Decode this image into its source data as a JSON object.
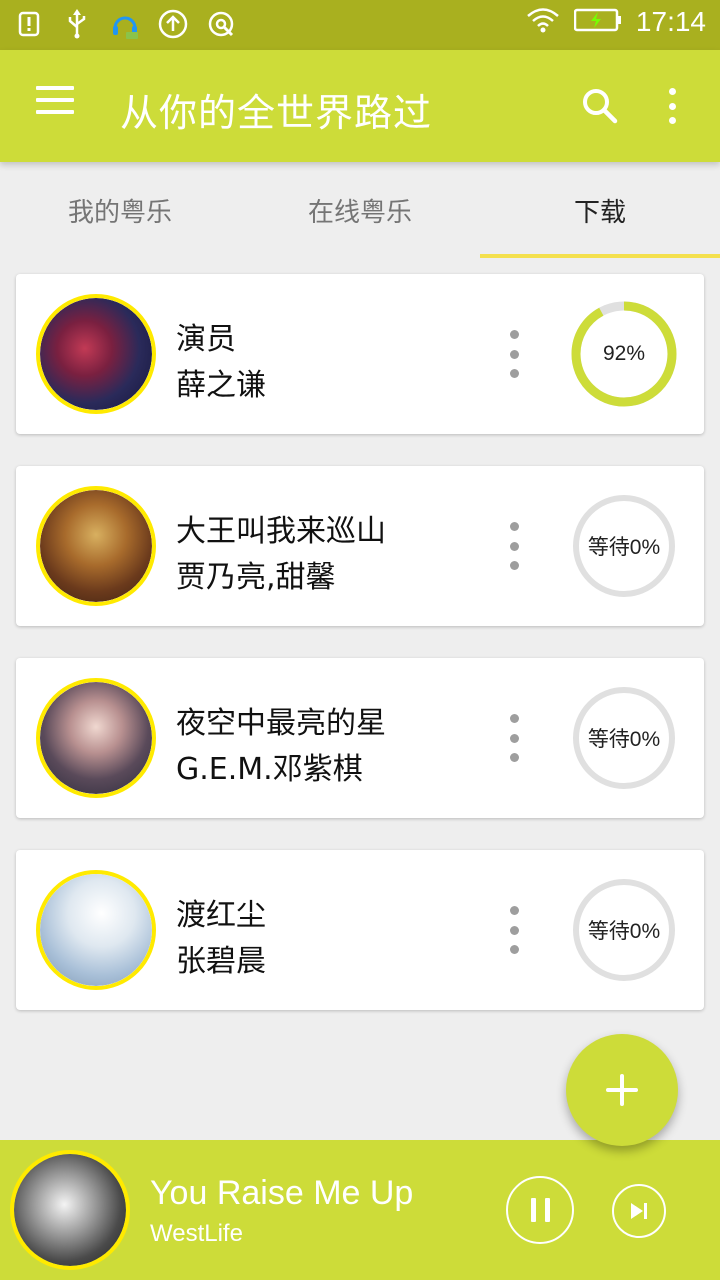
{
  "status_bar": {
    "time": "17:14",
    "icons": [
      "alert-icon",
      "usb-icon",
      "headset-icon",
      "upload-icon",
      "sync-icon",
      "wifi-icon",
      "battery-icon"
    ]
  },
  "app_bar": {
    "title": "从你的全世界路过",
    "icons": [
      "menu-icon",
      "search-icon",
      "overflow-menu-icon"
    ]
  },
  "tabs": [
    {
      "label": "我的粤乐",
      "active": false
    },
    {
      "label": "在线粤乐",
      "active": false
    },
    {
      "label": "下载",
      "active": true
    }
  ],
  "downloads": [
    {
      "title": "演员",
      "artist": "薛之谦",
      "progress_label": "92%",
      "progress": 0.92
    },
    {
      "title": "大王叫我来巡山",
      "artist": "贾乃亮,甜馨",
      "progress_label": "等待0%",
      "progress": 0
    },
    {
      "title": "夜空中最亮的星",
      "artist": "G.E.M.邓紫棋",
      "progress_label": "等待0%",
      "progress": 0
    },
    {
      "title": "渡红尘",
      "artist": "张碧晨",
      "progress_label": "等待0%",
      "progress": 0
    }
  ],
  "fab": {
    "icon": "plus-icon"
  },
  "now_playing": {
    "title": "You Raise Me Up",
    "artist": "WestLife",
    "icons": [
      "pause-icon",
      "skip-next-icon"
    ]
  },
  "colors": {
    "primary": "#cddc39",
    "status_bar": "#a9b01f",
    "accent_border": "#ffea00",
    "tab_indicator": "#f4e04d",
    "progress_track": "#e0e0e0"
  }
}
